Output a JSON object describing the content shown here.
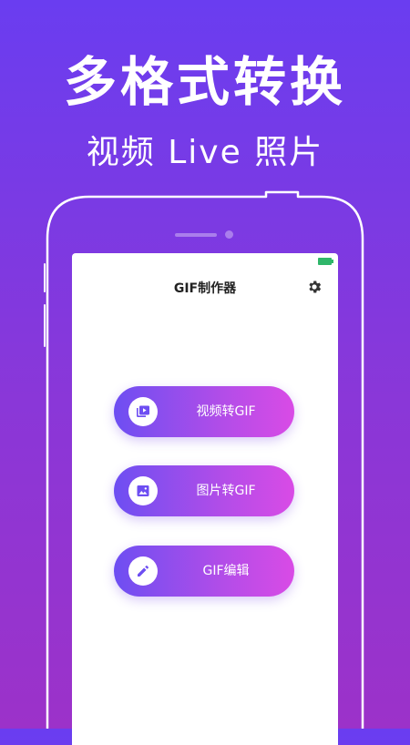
{
  "promo": {
    "headline": "多格式转换",
    "subline": "视频 Live 照片"
  },
  "app": {
    "title": "GIF制作器",
    "settings_icon": "gear-icon",
    "accent_start": "#6d4ef2",
    "accent_end": "#d94be6",
    "background_top": "#6a3df0",
    "background_bottom": "#9c32c9"
  },
  "actions": [
    {
      "label": "视频转GIF",
      "icon": "video-library-icon"
    },
    {
      "label": "图片转GIF",
      "icon": "image-icon"
    },
    {
      "label": "GIF编辑",
      "icon": "pencil-icon"
    }
  ]
}
